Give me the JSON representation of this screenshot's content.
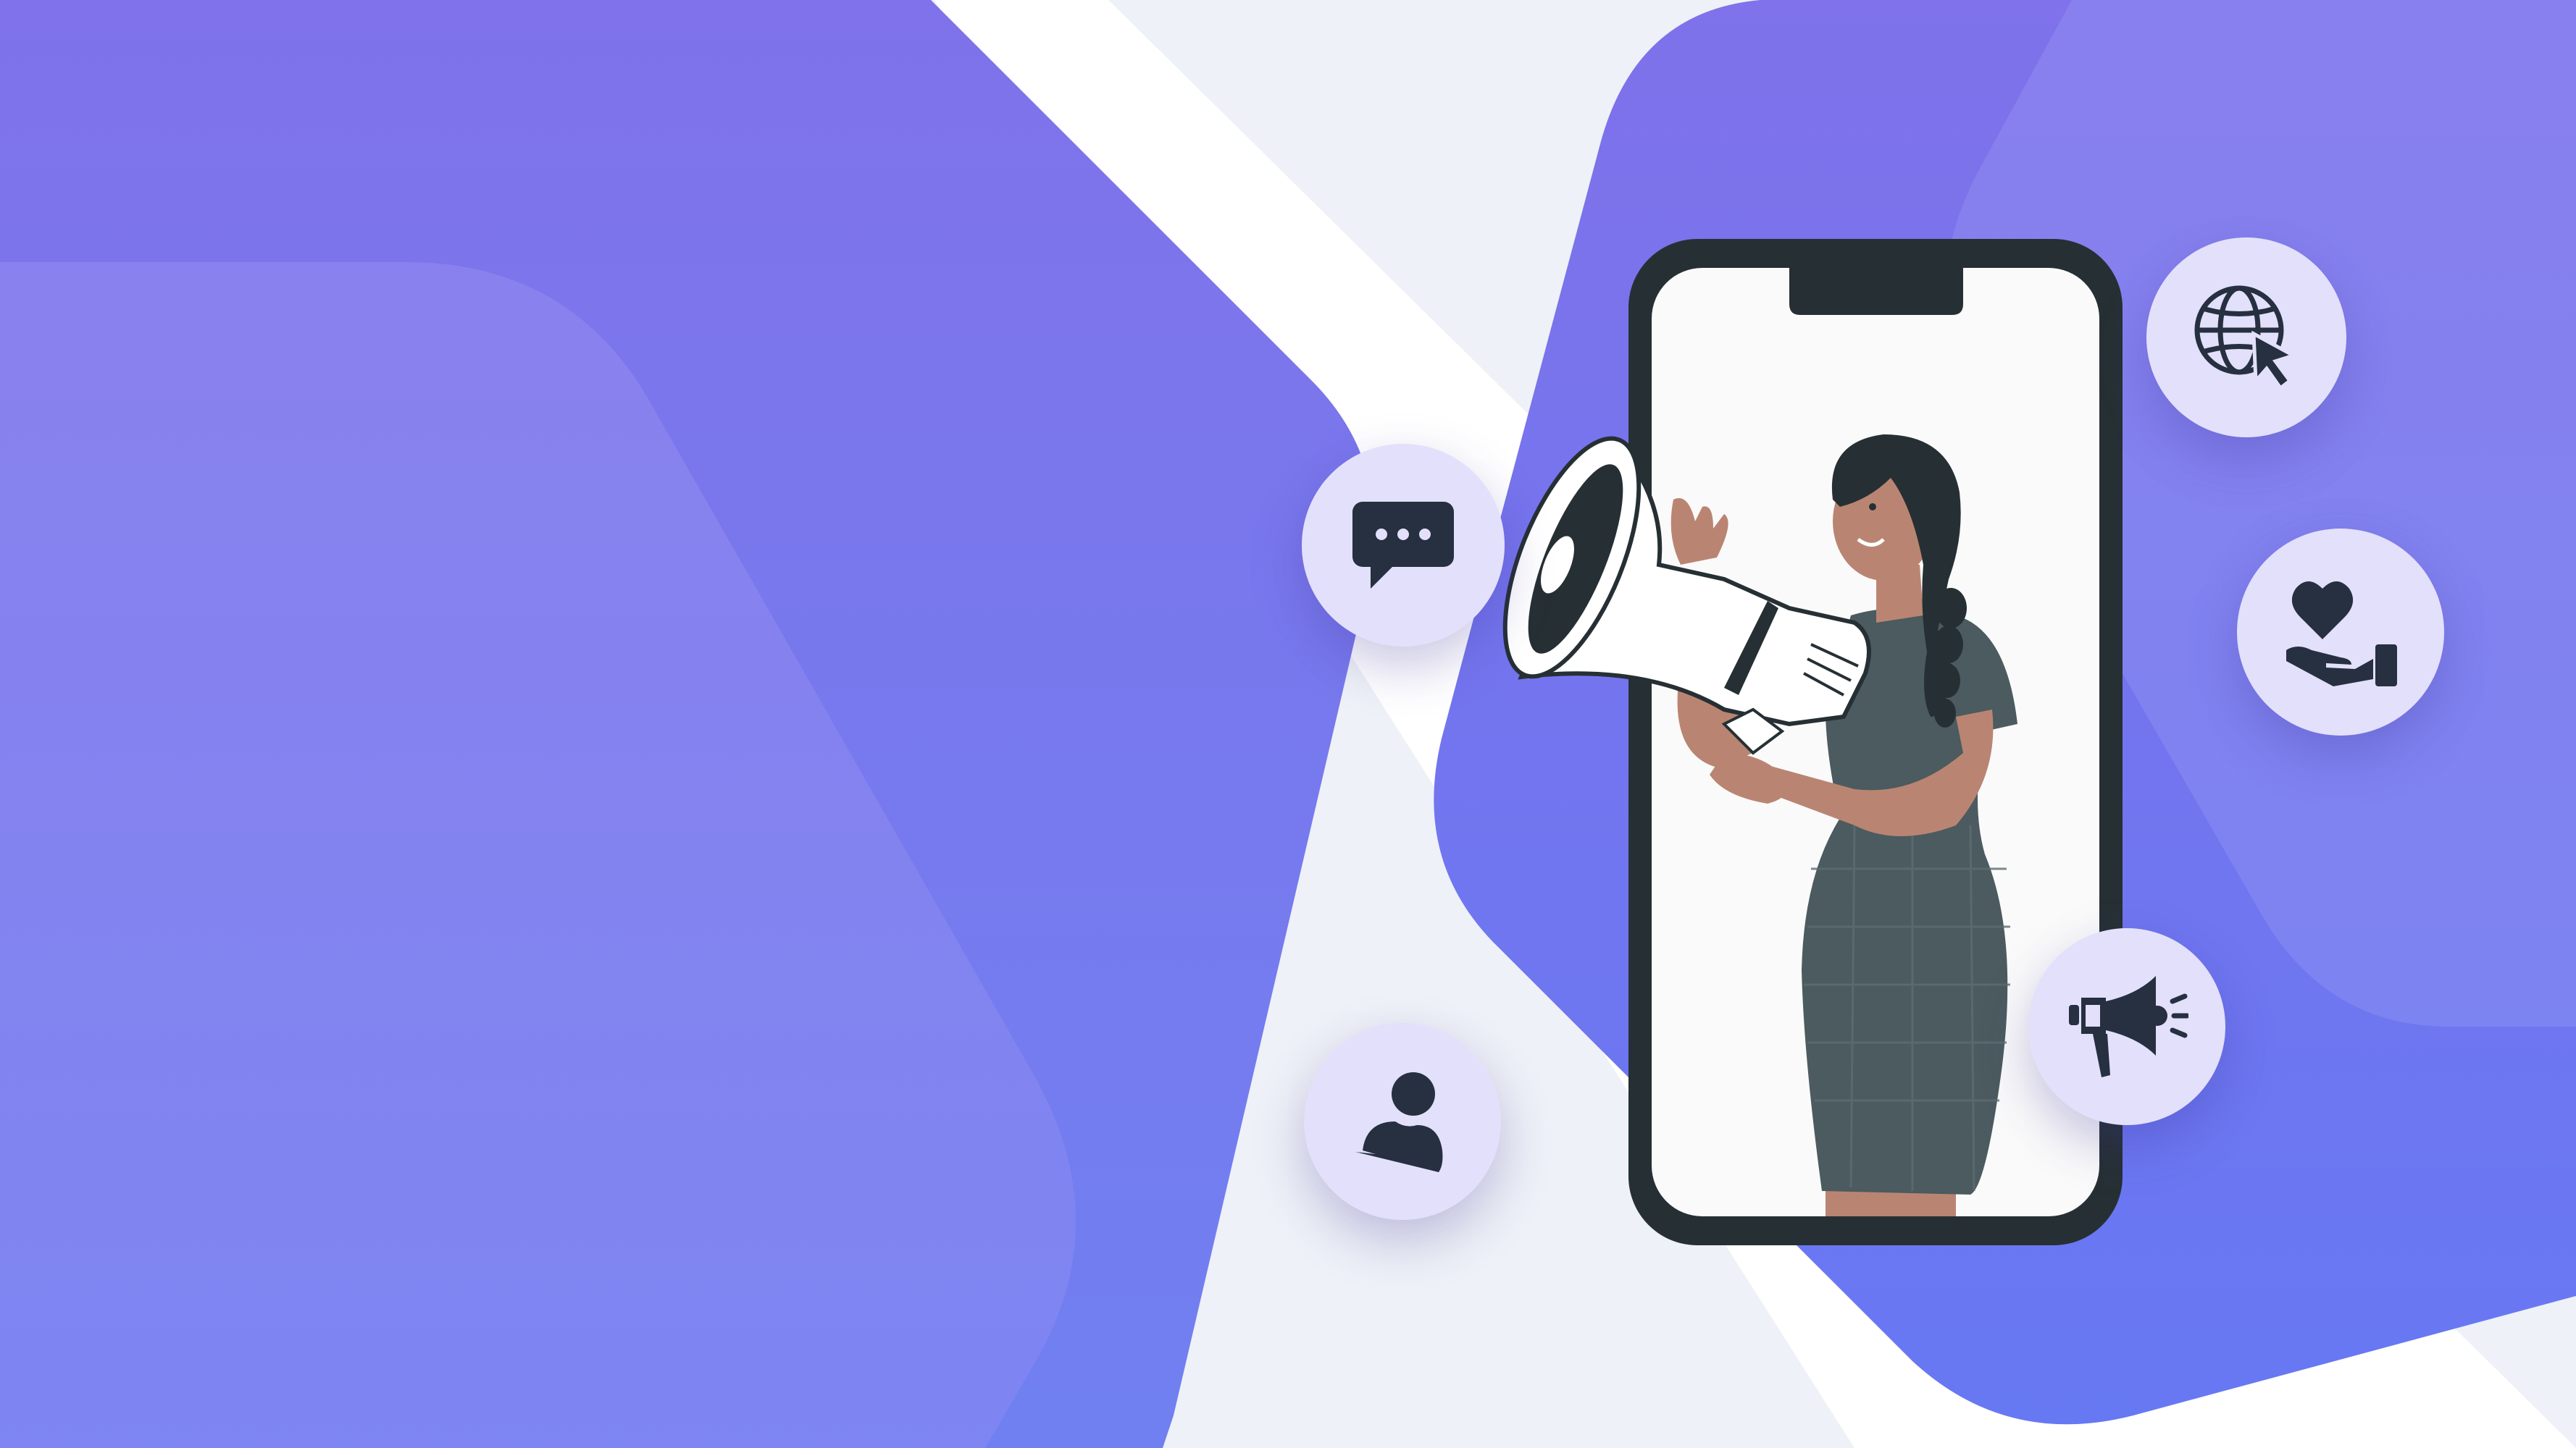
{
  "banner": {
    "colors": {
      "background": "#eef1f7",
      "accent_purple": "#7b74e8",
      "accent_purple_light": "#8a84ee",
      "accent_blue": "#6b7af0",
      "icon_circle": "#e3e0fb",
      "icon_dark": "#263040",
      "phone_frame": "#263034",
      "phone_screen": "#fafafa",
      "dress": "#4b5b5f",
      "skin": "#b98572"
    },
    "illustration": {
      "subject": "woman-with-megaphone-in-smartphone"
    },
    "icons": [
      {
        "name": "chat-bubble-icon"
      },
      {
        "name": "user-profile-icon"
      },
      {
        "name": "globe-cursor-icon"
      },
      {
        "name": "heart-hand-icon"
      },
      {
        "name": "megaphone-icon"
      }
    ]
  }
}
